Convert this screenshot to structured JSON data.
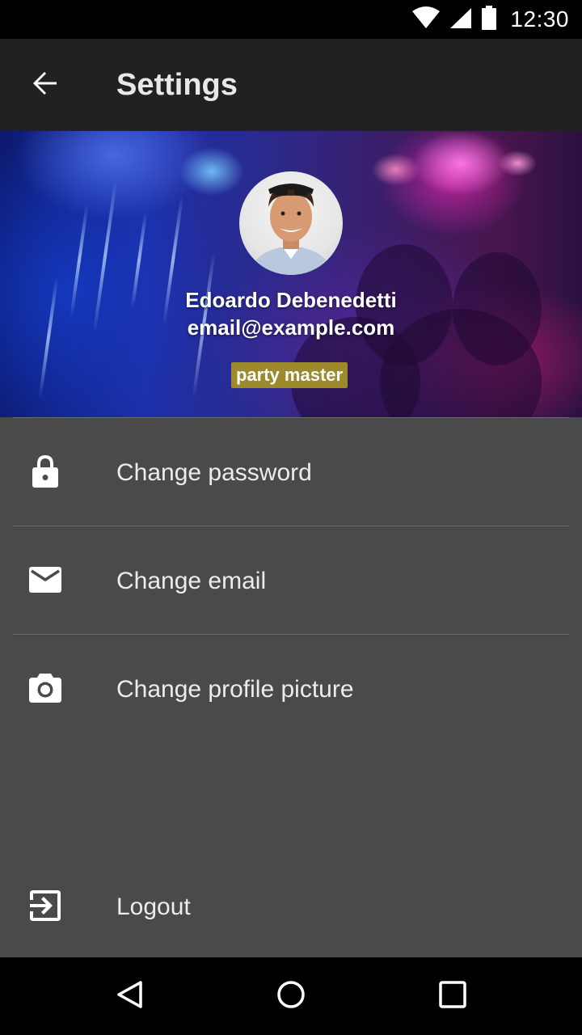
{
  "status_bar": {
    "time": "12:30",
    "icons": [
      "wifi-icon",
      "cellular-signal-icon",
      "battery-icon"
    ]
  },
  "app_bar": {
    "title": "Settings",
    "back_icon": "arrow-back-icon"
  },
  "profile": {
    "name": "Edoardo Debenedetti",
    "email": "email@example.com",
    "badge": "party master",
    "badge_color": "#9c8a2d"
  },
  "settings": {
    "items": [
      {
        "label": "Change password",
        "icon": "lock-icon"
      },
      {
        "label": "Change email",
        "icon": "mail-icon"
      },
      {
        "label": "Change profile picture",
        "icon": "camera-icon"
      }
    ],
    "logout": {
      "label": "Logout",
      "icon": "exit-icon"
    }
  },
  "nav_bar": {
    "icons": [
      "nav-back-icon",
      "nav-home-icon",
      "nav-recents-icon"
    ]
  },
  "colors": {
    "background": "#4a4a4a",
    "app_bar": "#212121",
    "status_bar": "#000000",
    "text_primary": "#ececec"
  }
}
